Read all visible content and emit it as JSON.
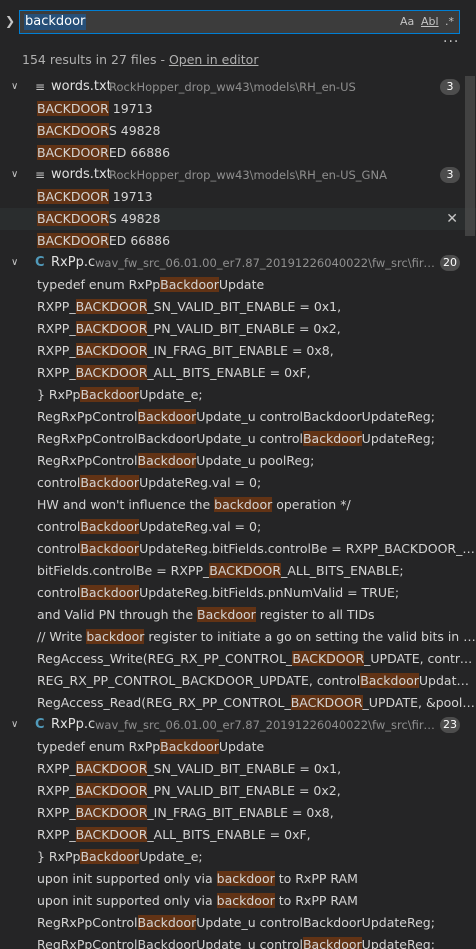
{
  "search": {
    "query": "backdoor",
    "case_label": "Aa",
    "word_label": "Abl",
    "regex_label": ".*",
    "more_label": "···"
  },
  "summary": {
    "text": "154 results in 27 files - ",
    "link": "Open in editor"
  },
  "files": [
    {
      "name": "words.txt",
      "path": "RockHopper_drop_ww43\\models\\RH_en-US",
      "icon": "text-file-icon",
      "count": "3",
      "lines": [
        [
          "",
          "BACKDOOR",
          " 19713"
        ],
        [
          "",
          "BACKDOOR",
          "S 49828"
        ],
        [
          "",
          "BACKDOOR",
          "ED 66886"
        ]
      ]
    },
    {
      "name": "words.txt",
      "path": "RockHopper_drop_ww43\\models\\RH_en-US_GNA",
      "icon": "text-file-icon",
      "count": "3",
      "selected_line": 1,
      "lines": [
        [
          "",
          "BACKDOOR",
          " 19713"
        ],
        [
          "",
          "BACKDOOR",
          "S 49828"
        ],
        [
          "",
          "BACKDOOR",
          "ED 66886"
        ]
      ]
    },
    {
      "name": "RxPp.c",
      "path": "wav_fw_src_06.01.00_er7.87_20191226040022\\fw_src\\firmware\\R...",
      "icon": "c-file-icon",
      "count": "20",
      "lines": [
        [
          "typedef enum RxPp",
          "Backdoor",
          "Update"
        ],
        [
          "RXPP_",
          "BACKDOOR",
          "_SN_VALID_BIT_ENABLE = 0x1,"
        ],
        [
          "RXPP_",
          "BACKDOOR",
          "_PN_VALID_BIT_ENABLE = 0x2,"
        ],
        [
          "RXPP_",
          "BACKDOOR",
          "_IN_FRAG_BIT_ENABLE = 0x8,"
        ],
        [
          "RXPP_",
          "BACKDOOR",
          "_ALL_BITS_ENABLE = 0xF,"
        ],
        [
          "} RxPp",
          "Backdoor",
          "Update_e;"
        ],
        [
          "RegRxPpControl",
          "Backdoor",
          "Update_u controlBackdoorUpdateReg;"
        ],
        [
          "RegRxPpControlBackdoorUpdate_u control",
          "Backdoor",
          "UpdateReg;"
        ],
        [
          "RegRxPpControl",
          "Backdoor",
          "Update_u poolReg;"
        ],
        [
          "control",
          "Backdoor",
          "UpdateReg.val = 0;"
        ],
        [
          "HW and won't influence the ",
          "backdoor",
          " operation */"
        ],
        [
          "control",
          "Backdoor",
          "UpdateReg.val = 0;"
        ],
        [
          "control",
          "Backdoor",
          "UpdateReg.bitFields.controlBe = RXPP_BACKDOOR_ALL_B..."
        ],
        [
          "bitFields.controlBe = RXPP_",
          "BACKDOOR",
          "_ALL_BITS_ENABLE;"
        ],
        [
          "control",
          "Backdoor",
          "UpdateReg.bitFields.pnNumValid = TRUE;"
        ],
        [
          "and Valid PN through the ",
          "Backdoor",
          " register to all TIDs"
        ],
        [
          "// Write ",
          "backdoor",
          " register to initiate a go on setting the valid bits in RXPP ..."
        ],
        [
          "RegAccess_Write(REG_RX_PP_CONTROL_",
          "BACKDOOR",
          "_UPDATE, controlBack..."
        ],
        [
          "REG_RX_PP_CONTROL_BACKDOOR_UPDATE, control",
          "Backdoor",
          "UpdateReg.v..."
        ],
        [
          "RegAccess_Read(REG_RX_PP_CONTROL_",
          "BACKDOOR",
          "_UPDATE, &poolReg.v..."
        ]
      ]
    },
    {
      "name": "RxPp.c",
      "path": "wav_fw_src_06.01.00_er7.87_20191226040022\\fw_src\\firmware\\R...",
      "icon": "c-file-icon",
      "count": "23",
      "lines": [
        [
          "typedef enum RxPp",
          "Backdoor",
          "Update"
        ],
        [
          "RXPP_",
          "BACKDOOR",
          "_SN_VALID_BIT_ENABLE = 0x1,"
        ],
        [
          "RXPP_",
          "BACKDOOR",
          "_PN_VALID_BIT_ENABLE = 0x2,"
        ],
        [
          "RXPP_",
          "BACKDOOR",
          "_IN_FRAG_BIT_ENABLE = 0x8,"
        ],
        [
          "RXPP_",
          "BACKDOOR",
          "_ALL_BITS_ENABLE = 0xF,"
        ],
        [
          "} RxPp",
          "Backdoor",
          "Update_e;"
        ],
        [
          "upon init supported only via ",
          "backdoor",
          " to RxPP RAM"
        ],
        [
          "upon init supported only via ",
          "backdoor",
          " to RxPP RAM"
        ],
        [
          "RegRxPpControl",
          "Backdoor",
          "Update_u controlBackdoorUpdateReg;"
        ],
        [
          "RegRxPpControlBackdoorUpdate_u control",
          "Backdoor",
          "UpdateReg;"
        ]
      ]
    }
  ]
}
